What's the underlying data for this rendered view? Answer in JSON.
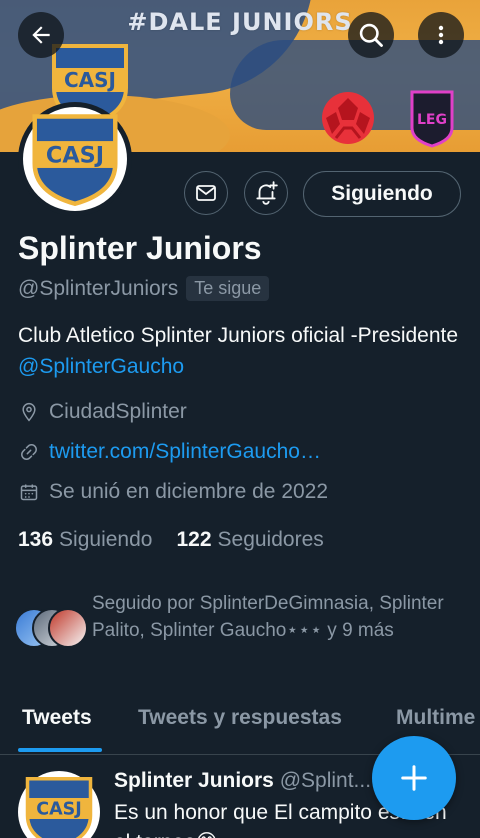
{
  "banner": {
    "hashtag": "#DALE JUNIORS",
    "crest_text": "CASJ",
    "league_text": "LEG"
  },
  "profile": {
    "avatar_text": "CASJ",
    "display_name": "Splinter Juniors",
    "handle": "@SplinterJuniors",
    "follows_you": "Te sigue",
    "bio_text": "Club Atletico Splinter Juniors oficial -Presidente ",
    "bio_mention": "@SplinterGaucho",
    "location": "CiudadSplinter",
    "link": "twitter.com/SplinterGaucho…",
    "joined": "Se unió en diciembre de 2022",
    "following_count": "136",
    "following_label": "Siguiendo",
    "followers_count": "122",
    "followers_label": "Seguidores",
    "followed_by": "Seguido por SplinterDeGimnasia, Splinter Palito, Splinter Gaucho⋆⋆⋆ y 9 más"
  },
  "actions": {
    "following_button": "Siguiendo"
  },
  "tabs": [
    {
      "label": "Tweets",
      "active": true
    },
    {
      "label": "Tweets y respuestas",
      "active": false
    },
    {
      "label": "Multime",
      "active": false
    }
  ],
  "tweet": {
    "avatar_text": "CASJ",
    "name": "Splinter Juniors",
    "handle": "@Splint...",
    "text": "Es un honor que El campito este en el torneo😊"
  },
  "colors": {
    "accent": "#1d9bf0",
    "background": "#15202b",
    "crest_blue": "#2b5a9c",
    "crest_gold": "#f0b53d"
  },
  "icons": [
    "back-arrow-icon",
    "search-icon",
    "more-vertical-icon",
    "mail-icon",
    "bell-plus-icon",
    "location-pin-icon",
    "link-icon",
    "calendar-icon",
    "plus-icon"
  ]
}
